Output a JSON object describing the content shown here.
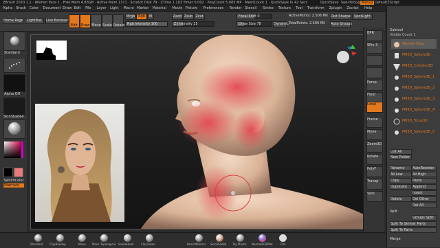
{
  "titlebar": {
    "title": "ZBrush 2020.1.1 · Women Face 1 · Free Mem 4.83GB · Active Mem 1371 · Scratch Disk 79 · ZTime 1.103 Timer 0.002 · PolyCount 5.005 MP · MeshCount 1 · QuickSave In 42 Secs",
    "quicksave": "QuickSave",
    "see_through": "See-through 0",
    "menus_btn": "Menus",
    "default_script": "DefaultZScript"
  },
  "menus": [
    "Alpha",
    "Brush",
    "Color",
    "Document",
    "Draw",
    "Edit",
    "File",
    "Layer",
    "Light",
    "Macro",
    "Marker",
    "Material",
    "Movie",
    "Picture",
    "Preferences",
    "Render",
    "Stencil",
    "Stroke",
    "Texture",
    "Tool",
    "Transform",
    "Zplugin",
    "Zscript",
    "Help"
  ],
  "shelf": {
    "home_page": "Home Page",
    "lightbox": "LightBox",
    "live_boolean": "Live Boolean",
    "edit": "Edit",
    "draw": "Draw",
    "move": "Move",
    "scale": "Scale",
    "rotate": "Rotate",
    "mrgb": "Mrgb",
    "rgb": "Rgb",
    "m": "M",
    "zadd": "Zadd",
    "zsub": "Zsub",
    "zcut": "Zcut",
    "rgb_intensity": "Rgb Intensity 100",
    "z_intensity": "Z Intensity 25",
    "focal_shift": "Focal Shift 0",
    "draw_size": "Draw Size 78",
    "dynamic": "Dynamic",
    "active_points": "ActivePoints: 2.506 Mil",
    "total_points": "TotalPoints: 2.506 Mil",
    "dist": "Dist Sharpe",
    "spotlight": "SpotLight",
    "auto_groups": "Auto Groups"
  },
  "left": {
    "brush_label": "Standard",
    "stroke_label": "Dots",
    "alpha_label": "Alpha Off",
    "texture_label": "Texture Off",
    "material_label": "SkinShade4",
    "gradient": "Gradient",
    "switch_color": "SwitchColor",
    "alternate": "Alternate"
  },
  "right": {
    "bpr": "BPR",
    "spix": "SPix 3",
    "persp": "Persp",
    "floor": "Floor",
    "local": "Local",
    "frame": "Frame",
    "move": "Move",
    "zoom3d": "Zoom3D",
    "rotate": "Rotate",
    "polyf": "PolyF",
    "transp": "Transp",
    "solo": "Solo"
  },
  "palette": {
    "title": "Subtool",
    "visible_count": "Visible Count 1",
    "subtools": [
      "Women Face",
      "PM3D_Sphere3D",
      "PM3D_Cylinder3D",
      "PM3D_Sphere3D_1",
      "PM3D_Sphere3D_2",
      "PM3D_Sphere3D_3",
      "PM3D_Sphere3D_4",
      "PM3D_Torus3D",
      "PM3D_Sphere3D_5"
    ],
    "list_all": "List All",
    "new_folder": "New Folder",
    "rename": "Rename",
    "autoreorder": "AutoReorder",
    "all_low": "All Low",
    "all_high": "All High",
    "copy": "Copy",
    "paste": "Paste",
    "duplicate": "Duplicate",
    "append": "Append",
    "insert": "Insert",
    "delete": "Delete",
    "del_other": "Del Other",
    "del_all": "Del All",
    "split": "Split",
    "groups_split": "Groups Split",
    "split_similar": "Split To Similar Parts",
    "split_parts": "Split To Parts",
    "merge": "Merge"
  },
  "bottom_tray": [
    "Standard",
    "ClayBuildup",
    "Move",
    "Move Topological",
    "SnakeHook",
    "ClayTubes",
    "BasicMaterial",
    "SkinShade4",
    "Toy Plastic",
    "NormalRGBMat",
    "Flat"
  ],
  "colors": {
    "accent": "#e4781c",
    "skin": "#e9c2a6",
    "paint": "#e34850",
    "brush_ring": "#d64040"
  }
}
